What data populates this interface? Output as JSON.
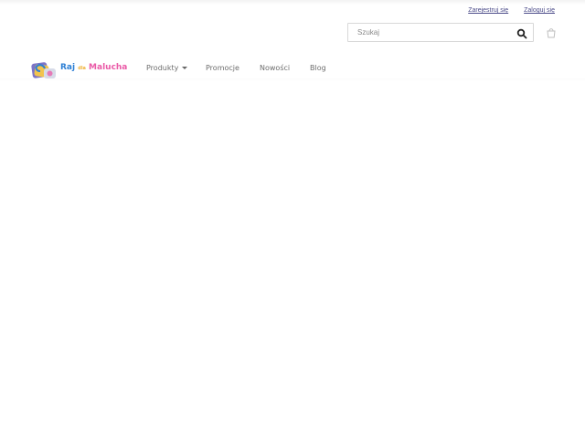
{
  "top_links": {
    "register": "Zarejestruj się",
    "login": "Zaloguj się"
  },
  "search": {
    "placeholder": "Szukaj",
    "value": ""
  },
  "logo": {
    "part1": "Raj",
    "part2": "dla",
    "part3": "Malucha"
  },
  "nav": {
    "items": [
      {
        "label": "Produkty"
      },
      {
        "label": "Promocje"
      },
      {
        "label": "Nowości"
      },
      {
        "label": "Blog"
      }
    ]
  },
  "colors": {
    "top_link": "#4a4a88",
    "nav_text": "#6d6d6d",
    "logo_blue": "#2d7fd4",
    "logo_pink": "#ea5aa7",
    "logo_yellow": "#f0b237"
  },
  "icons": {
    "search": "search-icon",
    "cart": "cart-icon",
    "logo_toy": "toy-blocks-icon",
    "dropdown": "chevron-down-icon"
  }
}
